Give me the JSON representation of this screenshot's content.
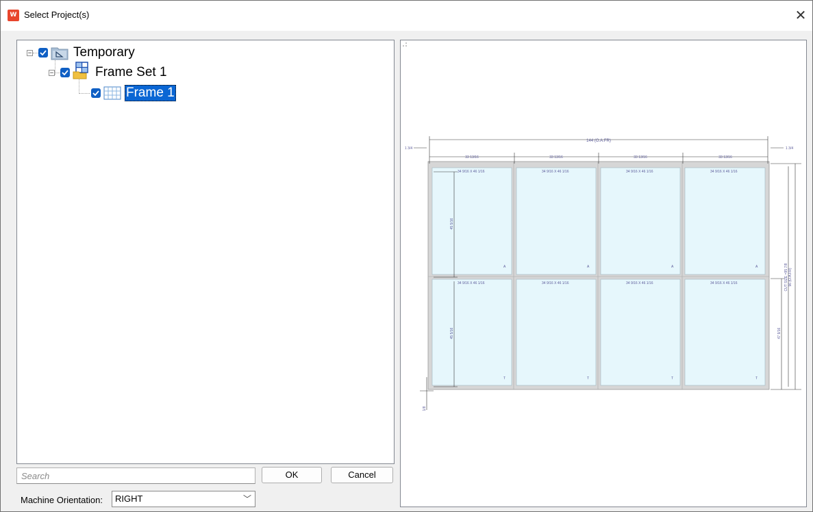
{
  "window": {
    "title": "Select Project(s)",
    "close_glyph": "✕",
    "app_icon_label": "W"
  },
  "tree": {
    "nodes": [
      {
        "label": "Temporary",
        "checked": true,
        "icon": "folder-icon",
        "expanded": true
      },
      {
        "label": "Frame Set 1",
        "checked": true,
        "icon": "frame-set-icon",
        "expanded": true
      },
      {
        "label": "Frame 1",
        "checked": true,
        "icon": "frame-grid-icon",
        "selected": true
      }
    ],
    "expander_glyph": "−"
  },
  "search": {
    "placeholder": "Search",
    "value": ""
  },
  "buttons": {
    "ok": "OK",
    "cancel": "Cancel"
  },
  "orientation": {
    "label": "Machine Orientation:",
    "value": "RIGHT",
    "arrow": "﹀"
  },
  "drawing": {
    "overall_width": "144 (O.A.FR)",
    "left_offset": "1 3/4",
    "right_offset": "1 3/4",
    "column_widths": [
      "33 13/16",
      "33 13/16",
      "33 13/16",
      "33 13/16"
    ],
    "panel_size": "34 9/16 X 46 1/16",
    "top_row_height": "45 5/16",
    "bottom_row_height": "45 5/16",
    "right_bottom_height": "47 9/16",
    "cut_size": "CUT SIZE =95 7/8",
    "overall_height": "96 (O.A.FR)",
    "bottom_offset": "1/8",
    "top_row_mark": "A",
    "bottom_row_mark": "T"
  },
  "colors": {
    "accent": "#0f5fc4",
    "selection": "#0a66d4",
    "glass": "#e6f7fc",
    "frame": "#d2d2d2",
    "app_icon": "#e8452c"
  }
}
